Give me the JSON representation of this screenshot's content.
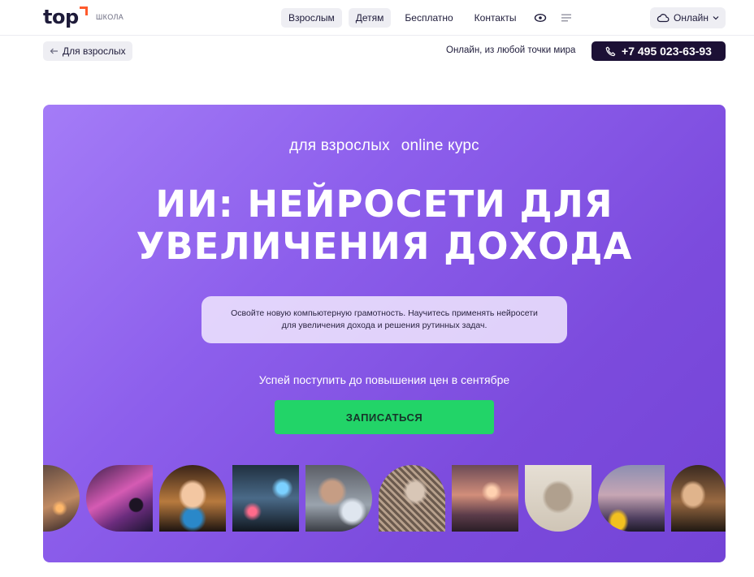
{
  "header": {
    "logo": "top",
    "logo_sub": "ШКОЛА",
    "nav": [
      "Взрослым",
      "Детям",
      "Бесплатно",
      "Контакты"
    ],
    "format_button": "Онлайн",
    "icons": [
      "eye-icon",
      "menu-icon",
      "cloud-icon",
      "chevron-down-icon"
    ]
  },
  "subbar": {
    "back_label": "Для взрослых",
    "location": "Онлайн, из любой точки мира",
    "phone": "+7 495 023-63-93"
  },
  "hero": {
    "tag_audience": "для взрослых",
    "tag_format": "online курс",
    "title_line1": "ИИ: НЕЙРОСЕТИ ДЛЯ",
    "title_line2": "УВЕЛИЧЕНИЯ ДОХОДА",
    "desc_line1": "Освойте новую компьютерную грамотность. Научитесь применять нейросети",
    "desc_line2": "для увеличения дохода и решения рутинных задач.",
    "promo": "Успей поступить до повышения цен в сентябре",
    "cta": "ЗАПИСАТЬСЯ"
  },
  "gallery": [
    {
      "name": "city-lights-image"
    },
    {
      "name": "neon-city-figure-image"
    },
    {
      "name": "ai-woman-portrait-image"
    },
    {
      "name": "night-city-traffic-image"
    },
    {
      "name": "man-hologram-image"
    },
    {
      "name": "cyborg-woman-profile-image"
    },
    {
      "name": "futuristic-street-image"
    },
    {
      "name": "android-face-image"
    },
    {
      "name": "city-car-image"
    },
    {
      "name": "cyborg-portrait-image"
    }
  ],
  "colors": {
    "accent": "#ff5a2c",
    "hero_start": "#a47cf7",
    "hero_end": "#7444d6",
    "cta": "#22d468",
    "phone_bg": "#1c1035"
  }
}
